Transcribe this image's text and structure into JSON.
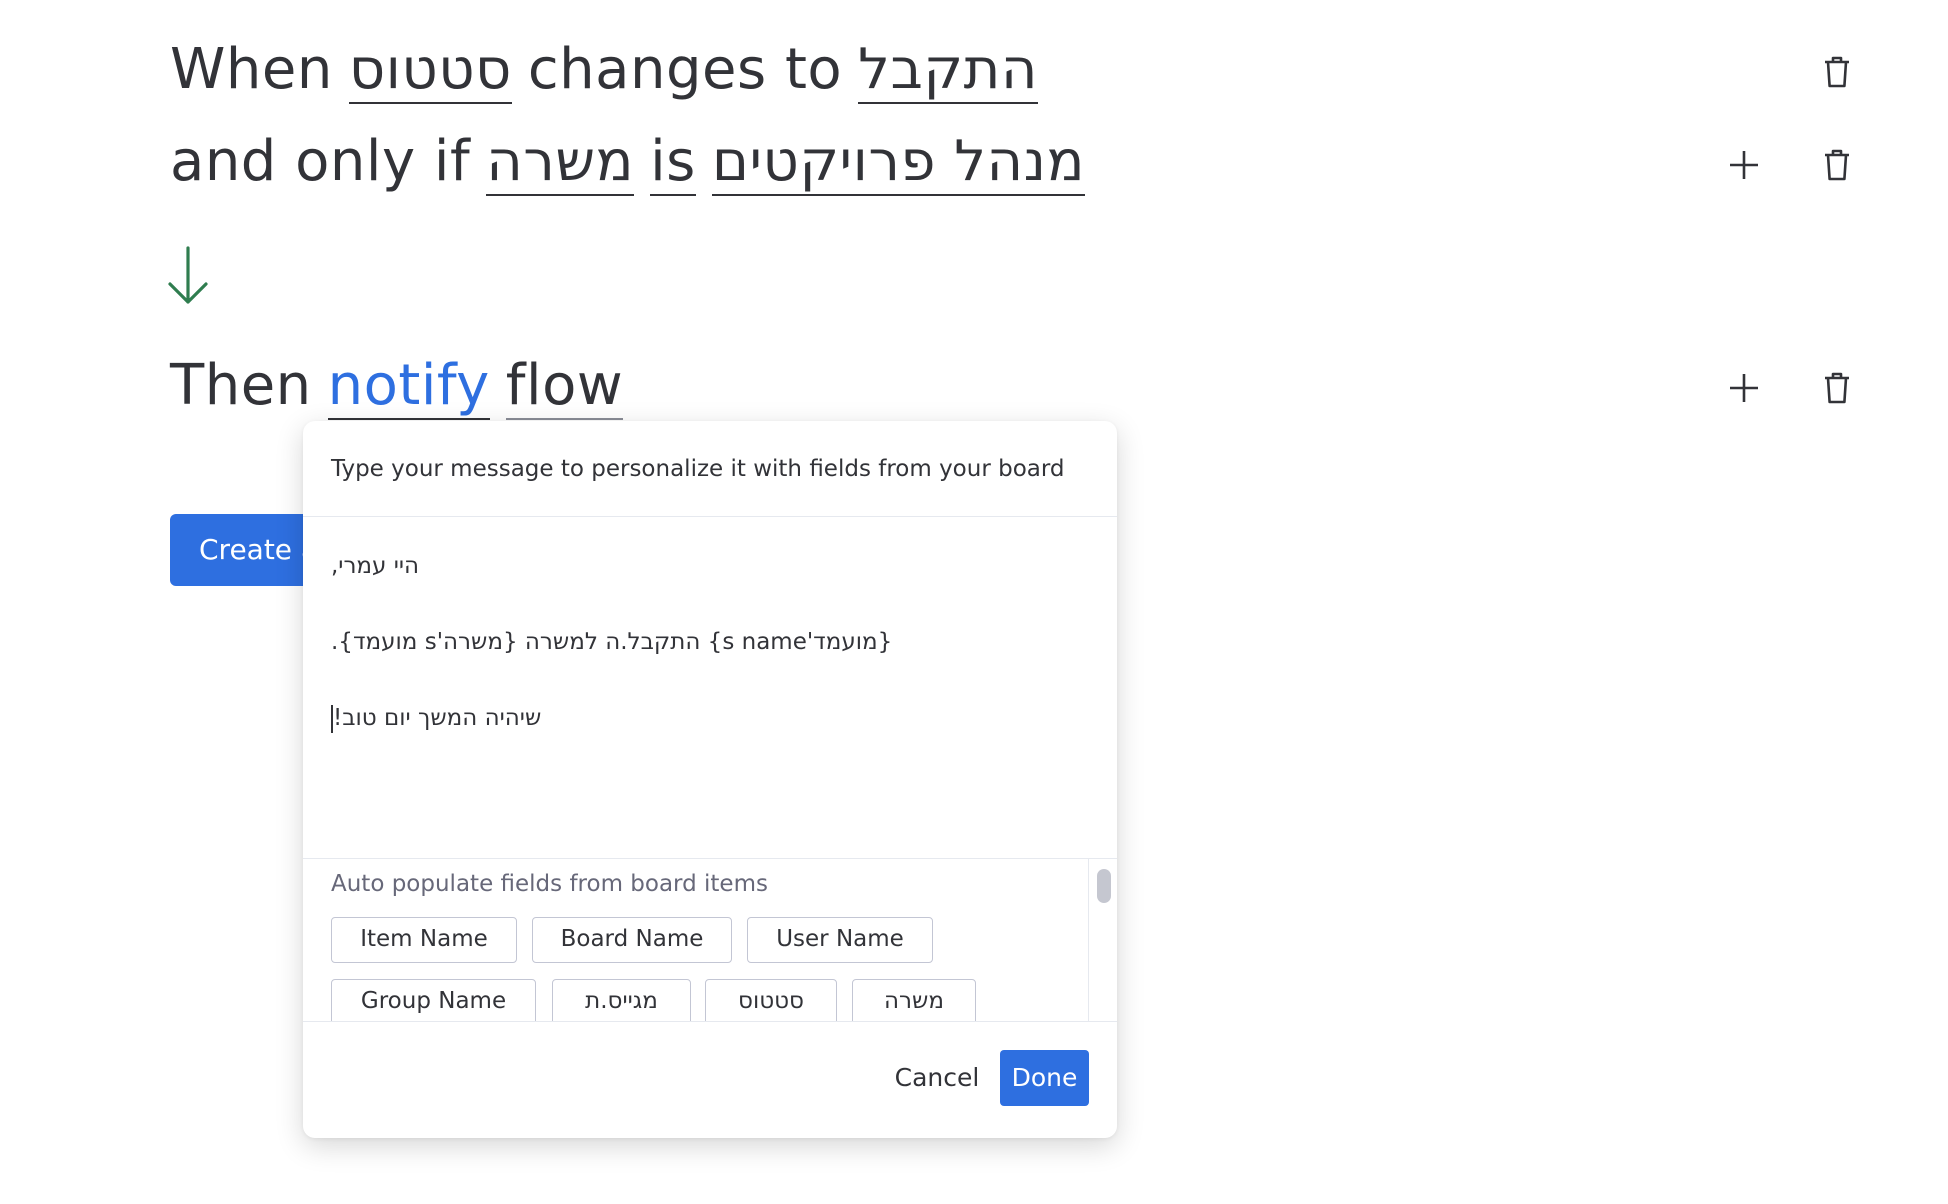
{
  "recipe": {
    "trigger": {
      "when": "When",
      "column": "סטטוס",
      "changes_to": "changes to",
      "value": "התקבל"
    },
    "condition": {
      "and_only_if": "and only if",
      "column": "משרה",
      "is": "is",
      "value": "מנהל פרויקטים"
    },
    "action": {
      "then": "Then",
      "verb": "notify",
      "target": "flow"
    }
  },
  "create_button": {
    "label": "Create a"
  },
  "dialog": {
    "header": "Type your message to personalize it with fields from your board",
    "message_lines": [
      "היי עמרי,",
      "{מועמד's name} התקבל.ה למשרה {משרה's מועמד}.",
      "שיהיה המשך יום טוב!"
    ],
    "fields_title": "Auto populate fields from board items",
    "chips": [
      "Item Name",
      "Board Name",
      "User Name",
      "Group Name",
      "מגייס.ת",
      "סטטוס",
      "משרה"
    ],
    "cancel_label": "Cancel",
    "done_label": "Done"
  },
  "colors": {
    "accent": "#2e6fe0",
    "arrow": "#2f7d4f",
    "text": "#323338"
  },
  "icons": [
    "trash-icon",
    "plus-icon",
    "arrow-down-icon"
  ]
}
